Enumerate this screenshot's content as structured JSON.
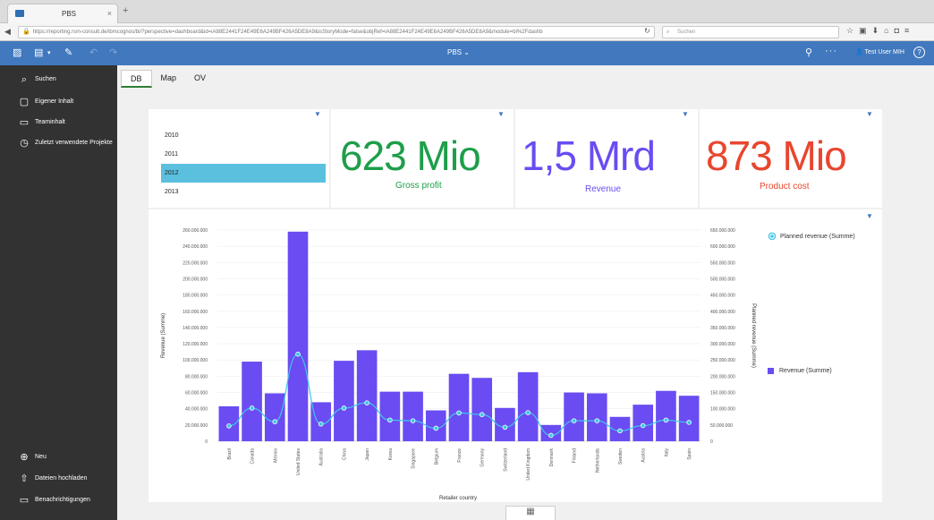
{
  "browser": {
    "tab_title": "PBS",
    "url": "https://reporting.rsm-consult.de/ibmcognos/bi/?perspective=dashboard&id=iA88E2441F24E49E6A249BF426A5DE8A9&isStoryMode=false&objRef=iA88E2441F24E49E6A249BF426A5DE8A9&module=bi%2Fdashb",
    "search_placeholder": "Suchen"
  },
  "header": {
    "title": "PBS",
    "user": "Test User MIH"
  },
  "sidebar": {
    "items": [
      {
        "label": "Suchen"
      },
      {
        "label": "Eigener Inhalt"
      },
      {
        "label": "Teaminhalt"
      },
      {
        "label": "Zuletzt verwendete Projekte"
      }
    ],
    "bottom_items": [
      {
        "label": "Neu"
      },
      {
        "label": "Dateien hochladen"
      },
      {
        "label": "Benachrichtigungen"
      }
    ]
  },
  "view_tabs": [
    {
      "label": "DB"
    },
    {
      "label": "Map"
    },
    {
      "label": "OV"
    }
  ],
  "years": [
    "2010",
    "2011",
    "2012",
    "2013"
  ],
  "kpis": [
    {
      "value": "623 Mio",
      "label": "Gross profit",
      "color": "#1e9e4a"
    },
    {
      "value": "1,5 Mrd",
      "label": "Revenue",
      "color": "#6a4cf2"
    },
    {
      "value": "873 Mio",
      "label": "Product cost",
      "color": "#e8462e"
    }
  ],
  "colors": {
    "bar": "#6a4cf2",
    "line": "#3fc6e8",
    "selected_year": "#5bc0de",
    "header": "#4178be",
    "sidebar": "#323232"
  },
  "chart_data": {
    "type": "bar",
    "xlabel": "Retailer country",
    "ylabel": "Revenue (Summe)",
    "y2label": "Planned revenue (Summe)",
    "ylim": [
      0,
      260000000
    ],
    "y2lim": [
      0,
      650000000
    ],
    "yticks": [
      "0",
      "20.000.000",
      "40.000.000",
      "60.000.000",
      "80.000.000",
      "100.000.000",
      "120.000.000",
      "140.000.000",
      "160.000.000",
      "180.000.000",
      "200.000.000",
      "220.000.000",
      "240.000.000",
      "260.000.000"
    ],
    "y2ticks": [
      "0",
      "50.000.000",
      "100.000.000",
      "150.000.000",
      "200.000.000",
      "250.000.000",
      "300.000.000",
      "350.000.000",
      "400.000.000",
      "450.000.000",
      "500.000.000",
      "550.000.000",
      "600.000.000",
      "650.000.000"
    ],
    "categories": [
      "Brazil",
      "Canada",
      "Mexico",
      "United States",
      "Australia",
      "China",
      "Japan",
      "Korea",
      "Singapore",
      "Belgium",
      "France",
      "Germany",
      "Switzerland",
      "United Kingdom",
      "Denmark",
      "Finland",
      "Netherlands",
      "Sweden",
      "Austria",
      "Italy",
      "Spain"
    ],
    "series": [
      {
        "name": "Revenue (Summe)",
        "type": "bar",
        "axis": "left",
        "values": [
          43000000,
          98000000,
          59000000,
          258000000,
          48000000,
          99000000,
          112000000,
          61000000,
          61000000,
          38000000,
          83000000,
          78000000,
          41000000,
          85000000,
          20000000,
          60000000,
          59000000,
          30000000,
          45000000,
          62000000,
          56000000
        ]
      },
      {
        "name": "Planned revenue (Summe)",
        "type": "line",
        "axis": "right",
        "values": [
          47000000,
          102000000,
          60000000,
          268000000,
          53000000,
          102000000,
          118000000,
          65000000,
          63000000,
          40000000,
          87000000,
          82000000,
          43000000,
          88000000,
          18000000,
          63000000,
          63000000,
          32000000,
          48000000,
          65000000,
          58000000
        ]
      }
    ],
    "legend": "right"
  }
}
